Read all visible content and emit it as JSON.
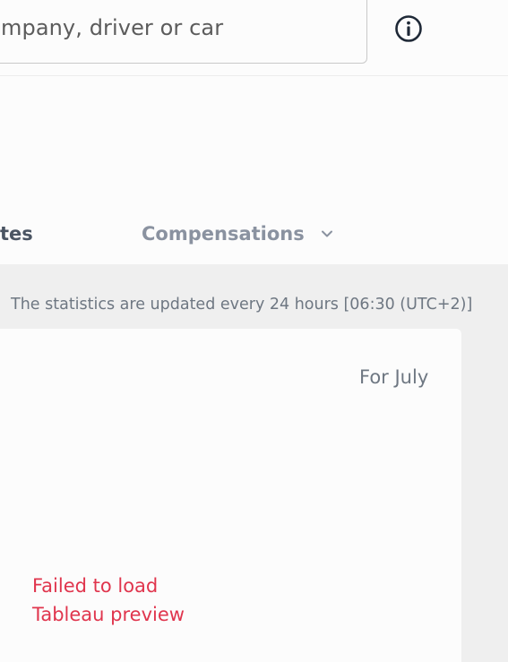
{
  "search": {
    "placeholder": "mpany, driver or car"
  },
  "header": {
    "info_icon": "info-circle-icon"
  },
  "tabs": [
    {
      "label": "tes"
    },
    {
      "label": "Compensations",
      "icon": "chevron-down-icon"
    }
  ],
  "stats": {
    "note": "The statistics are updated every 24 hours [06:30 (UTC+2)]"
  },
  "card": {
    "period": "For July",
    "error_line1": "Failed to load",
    "error_line2": "Tableau preview"
  },
  "colors": {
    "accent_error": "#e0354d",
    "text_muted": "#6e7782",
    "tab_inactive": "#8a92a0",
    "icon_dark": "#1f2937"
  }
}
